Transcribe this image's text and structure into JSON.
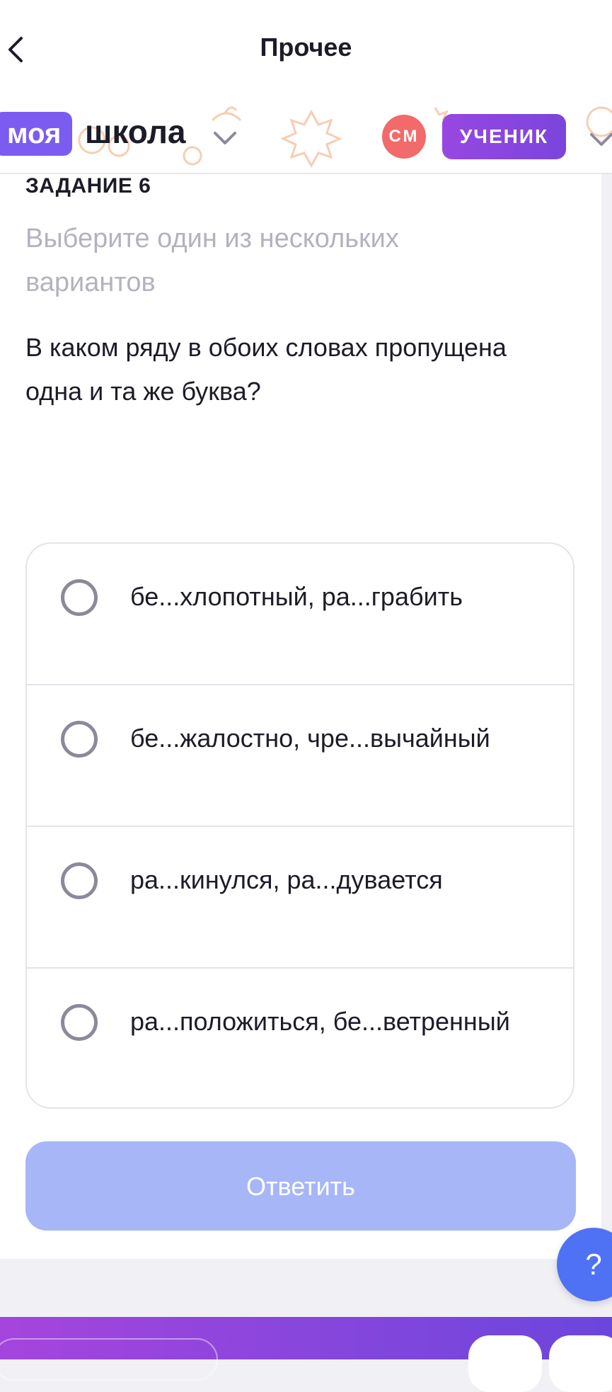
{
  "nav": {
    "title": "Прочее",
    "back_icon": "chevron-left-icon"
  },
  "header": {
    "logo_part1": "моя",
    "logo_part2": "школа",
    "avatar_initials": "СМ",
    "role_label": "УЧЕНИК",
    "colors": {
      "logo_bg": "#7b5cf0",
      "avatar_bg": "#f26a6a",
      "role_bg": "#8a46e0"
    }
  },
  "task": {
    "number_label": "ЗАДАНИЕ 6",
    "hint": "Выберите один из нескольких вариантов",
    "question": "В каком ряду в обоих словах пропущена одна и та же буква?",
    "options": [
      "бе...хлопотный, ра...грабить",
      "бе...жалостно, чре...вычайный",
      "ра...кинулся, ра...дувается",
      "ра...положиться, бе...ветренный"
    ],
    "selected_index": null,
    "answer_button": "Ответить",
    "answer_button_color": "#a6b6f7"
  },
  "help": {
    "label": "?",
    "icon": "question-icon",
    "color": "#4f72f5"
  }
}
